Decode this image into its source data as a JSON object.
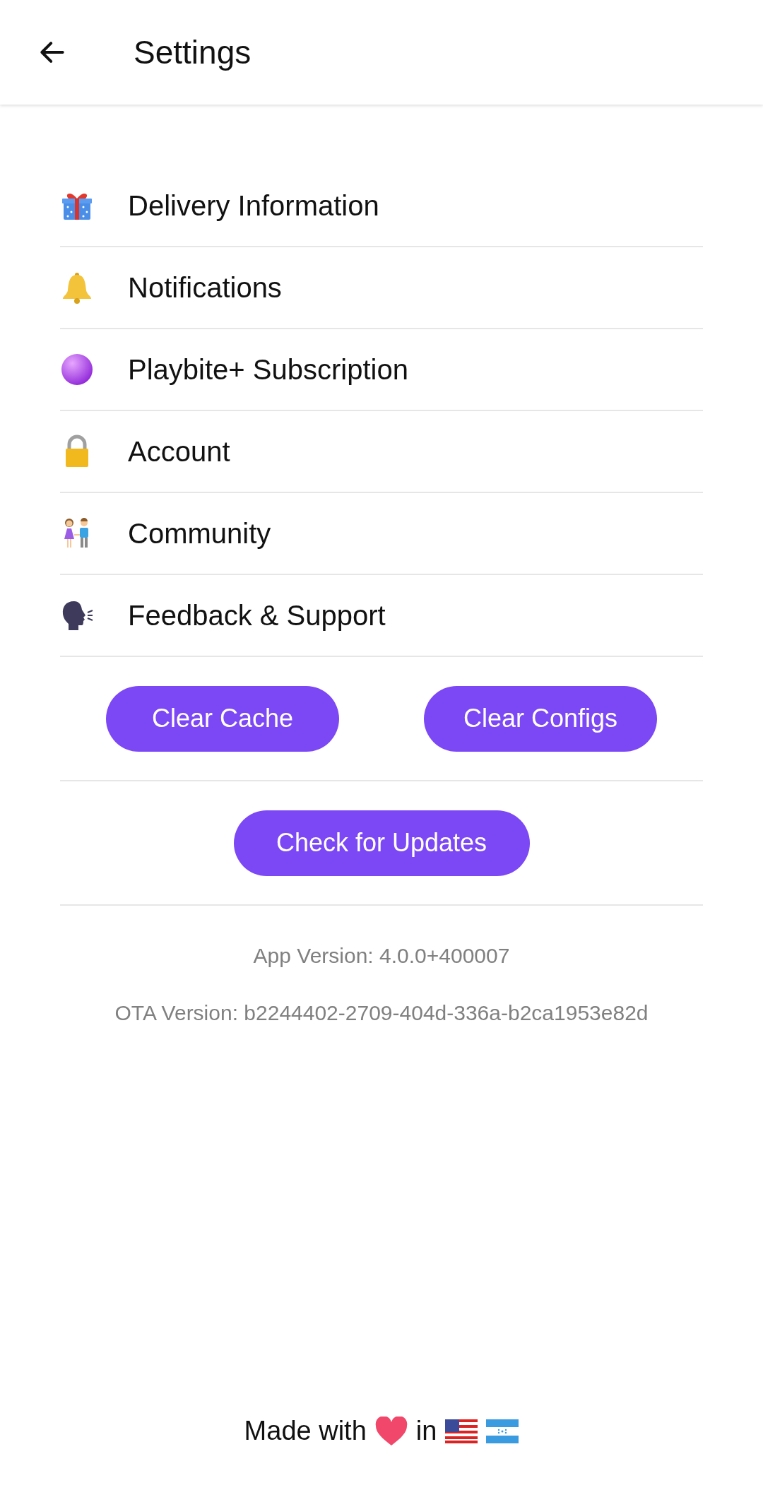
{
  "header": {
    "title": "Settings"
  },
  "items": [
    {
      "kind": "gift",
      "label": "Delivery Information"
    },
    {
      "kind": "bell",
      "label": "Notifications"
    },
    {
      "kind": "orb",
      "label": "Playbite+ Subscription"
    },
    {
      "kind": "lock",
      "label": "Account"
    },
    {
      "kind": "people",
      "label": "Community"
    },
    {
      "kind": "speaker",
      "label": "Feedback & Support"
    }
  ],
  "buttons": [
    "Clear Cache",
    "Clear Configs"
  ],
  "update_button": "Check for Updates",
  "app_version": "App Version: 4.0.0+400007",
  "ota_version": "OTA Version: b2244402-2709-404d-336a-b2ca1953e82d",
  "footer": {
    "before": "Made with",
    "between": "in"
  }
}
